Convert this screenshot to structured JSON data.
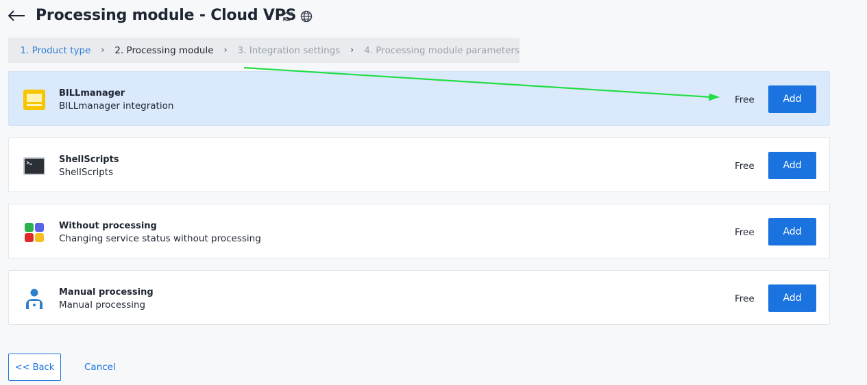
{
  "header": {
    "title": "Processing module - Cloud VPS"
  },
  "steps": [
    {
      "label": "1. Product type",
      "state": "done"
    },
    {
      "label": "2. Processing module",
      "state": "current"
    },
    {
      "label": "3. Integration settings",
      "state": "future"
    },
    {
      "label": "4. Processing module parameters",
      "state": "future"
    }
  ],
  "modules": [
    {
      "name": "BILLmanager",
      "description": "BILLmanager integration",
      "price": "Free",
      "button": "Add",
      "selected": true,
      "icon": "laptop-icon"
    },
    {
      "name": "ShellScripts",
      "description": "ShellScripts",
      "price": "Free",
      "button": "Add",
      "selected": false,
      "icon": "terminal-icon"
    },
    {
      "name": "Without processing",
      "description": "Changing service status without processing",
      "price": "Free",
      "button": "Add",
      "selected": false,
      "icon": "grid-icon"
    },
    {
      "name": "Manual processing",
      "description": "Manual processing",
      "price": "Free",
      "button": "Add",
      "selected": false,
      "icon": "person-laptop-icon"
    }
  ],
  "footer": {
    "back_label": "<< Back",
    "cancel_label": "Cancel"
  },
  "colors": {
    "accent": "#1a73de",
    "selected_bg": "#dae9fb",
    "annotation": "#22dd44"
  }
}
